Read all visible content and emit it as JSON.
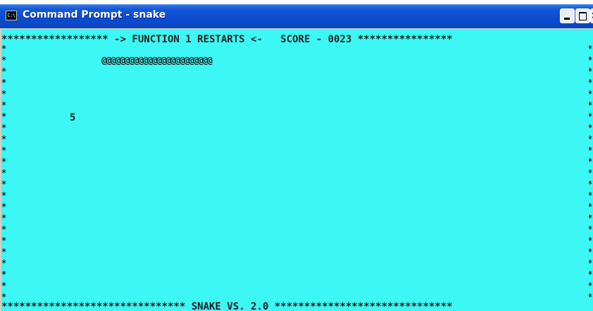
{
  "window": {
    "title": "Command Prompt - snake",
    "icon_name": "command-prompt-icon",
    "icon_glyph": "C:\\",
    "buttons": {
      "minimize": "minimize",
      "maximize": "maximize",
      "close": "×"
    }
  },
  "game": {
    "header_line": "****************** -> FUNCTION 1 RESTARTS <-   SCORE - 0023 ****************",
    "footer_line": "******************************* SNAKE VS. 2.0 ******************************",
    "border_char": "*",
    "snake_body": "@@@@@@@@@@@@@@@@@@@@@@@@",
    "food_value": "5",
    "score": "0023",
    "restart_hint": "FUNCTION 1 RESTARTS",
    "version": "SNAKE VS. 2.0"
  },
  "colors": {
    "console_background": "#3cf7f4",
    "console_text": "#1f1f1f",
    "titlebar": "#0b4cd0"
  }
}
